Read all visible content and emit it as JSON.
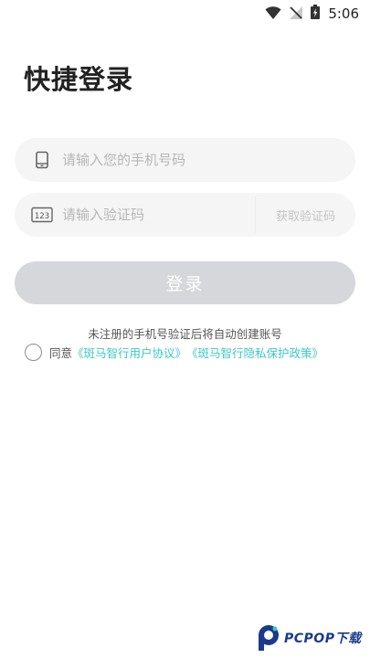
{
  "status_bar": {
    "time": "5:06",
    "icons": [
      "wifi-icon",
      "no-signal-icon",
      "battery-charging-icon"
    ]
  },
  "page": {
    "title": "快捷登录"
  },
  "phone_field": {
    "icon": "phone-icon",
    "placeholder": "请输入您的手机号码",
    "value": ""
  },
  "code_field": {
    "icon": "123-keypad-icon",
    "placeholder": "请输入验证码",
    "value": "",
    "get_code_label": "获取验证码"
  },
  "login_button": {
    "label": "登录",
    "state": "disabled"
  },
  "hint": "未注册的手机号验证后将自动创建账号",
  "agreement": {
    "checked": false,
    "prefix": "同意",
    "user_agreement": "《斑马智行用户协议》",
    "privacy_policy": "《斑马智行隐私保护政策》"
  },
  "colors": {
    "accent_link": "#3cc8c2",
    "button_disabled": "#d6d7da",
    "field_bg": "#f5f5f6"
  },
  "watermark": {
    "text": "PCPOP下载"
  }
}
